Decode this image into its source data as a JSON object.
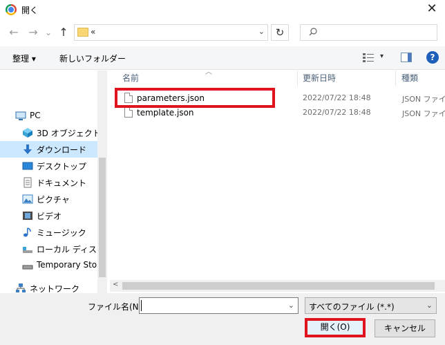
{
  "window": {
    "title": "開く",
    "close_glyph": "✕"
  },
  "navbar": {
    "back_glyph": "←",
    "forward_glyph": "→",
    "recent_glyph": "⌄",
    "up_glyph": "↑",
    "address_text": "«",
    "address_dropdown_glyph": "⌄",
    "refresh_glyph": "↻",
    "search_placeholder": ""
  },
  "commandbar": {
    "organize_label": "整理 ▾",
    "new_folder_label": "新しいフォルダー",
    "view_dropdown_glyph": "▾",
    "help_glyph": "?"
  },
  "sidebar": {
    "items": [
      {
        "label": "PC",
        "icon": "pc-icon"
      },
      {
        "label": "3D オブジェクト",
        "icon": "3d-objects-icon"
      },
      {
        "label": "ダウンロード",
        "icon": "downloads-icon",
        "active": true
      },
      {
        "label": "デスクトップ",
        "icon": "desktop-icon"
      },
      {
        "label": "ドキュメント",
        "icon": "documents-icon"
      },
      {
        "label": "ピクチャ",
        "icon": "pictures-icon"
      },
      {
        "label": "ビデオ",
        "icon": "videos-icon"
      },
      {
        "label": "ミュージック",
        "icon": "music-icon"
      },
      {
        "label": "ローカル ディスク (C",
        "icon": "local-disk-icon"
      },
      {
        "label": "Temporary Stora",
        "icon": "drive-icon"
      },
      {
        "label": "ネットワーク",
        "icon": "network-icon"
      }
    ]
  },
  "filelist": {
    "columns": {
      "name": "名前",
      "date": "更新日時",
      "type": "種類"
    },
    "files": [
      {
        "name": "parameters.json",
        "date": "2022/07/22 18:48",
        "type": "JSON ファイル",
        "highlighted": true
      },
      {
        "name": "template.json",
        "date": "2022/07/22 18:48",
        "type": "JSON ファイル"
      }
    ]
  },
  "footer": {
    "filename_label": "ファイル名(N):",
    "filename_value": "",
    "filename_dropdown_glyph": "⌄",
    "filetype_value": "すべてのファイル (*.*)",
    "filetype_dropdown_glyph": "⌄",
    "open_label": "開く(O)",
    "cancel_label": "キャンセル"
  },
  "colors": {
    "highlight_border": "#e0141e",
    "selected_nav": "#cce8ff"
  }
}
